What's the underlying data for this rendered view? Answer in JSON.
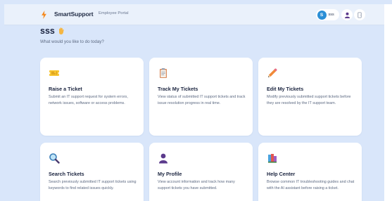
{
  "header": {
    "brand": "SmartSupport",
    "subtitle": "Employee Portal",
    "user_initial": "S",
    "user_name": "sss"
  },
  "greeting": {
    "title": "sss",
    "subtitle": "What would you like to do today?"
  },
  "cards": [
    {
      "icon": "ticket-icon",
      "title": "Raise a Ticket",
      "description": "Submit an IT support request for system errors, network issues, software or access problems."
    },
    {
      "icon": "clipboard-icon",
      "title": "Track My Tickets",
      "description": "View status of submitted IT support tickets and track issue resolution progress in real time."
    },
    {
      "icon": "pencil-icon",
      "title": "Edit My Tickets",
      "description": "Modify previously submitted support tickets before they are resolved by the IT support team."
    },
    {
      "icon": "magnifier-icon",
      "title": "Search Tickets",
      "description": "Search previously submitted IT support tickets using keywords to find related issues quickly."
    },
    {
      "icon": "user-icon",
      "title": "My Profile",
      "description": "View account information and track how many support tickets you have submitted."
    },
    {
      "icon": "books-icon",
      "title": "Help Center",
      "description": "Browse common IT troubleshooting guides and chat with the AI assistant before raising a ticket."
    }
  ],
  "colors": {
    "background": "#d9e6fa",
    "card": "#ffffff",
    "accent": "#2b8fd6",
    "brand_bolt": "#f58a1f"
  }
}
